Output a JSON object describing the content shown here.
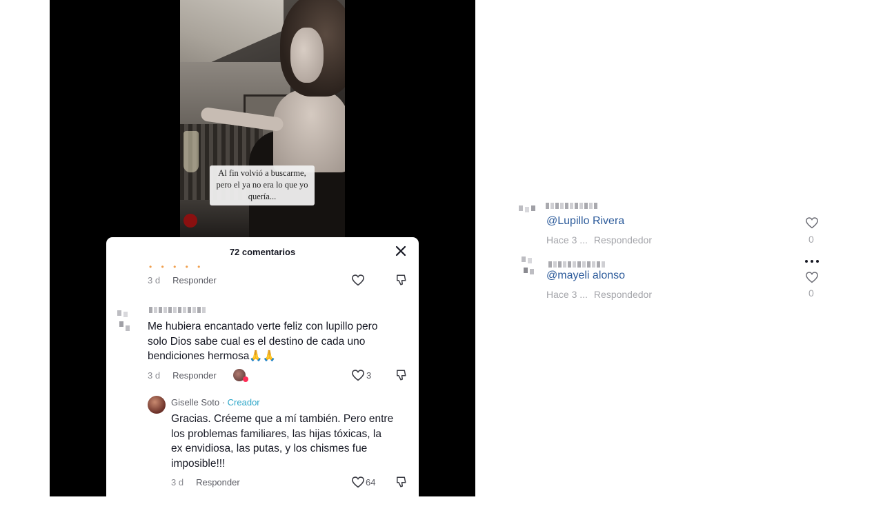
{
  "video": {
    "caption_lines": [
      "Al fin volvió a buscarme,",
      "pero el ya no era lo que yo",
      "quería..."
    ]
  },
  "comments_panel": {
    "title": "72 comentarios",
    "emoji_row": "• • • • •",
    "first_meta": {
      "time": "3 d",
      "reply": "Responder"
    },
    "comment": {
      "lines": [
        "Me hubiera encantado verte feliz con lupillo pero",
        "solo Dios sabe cual es el destino de cada uno",
        "bendiciones hermosa🙏🙏"
      ],
      "time": "3 d",
      "reply": "Responder",
      "likes": "3"
    },
    "creator_reply": {
      "author": "Giselle Soto",
      "separator": " · ",
      "badge": "Creador",
      "lines": [
        "Gracias. Créeme que a mí también. Pero entre",
        "los problemas familiares, las hijas tóxicas, la",
        "ex envidiosa, las putas, y los chismes fue",
        "imposible!!!"
      ],
      "time": "3 d",
      "reply": "Responder",
      "likes": "64"
    }
  },
  "right_comments": [
    {
      "mention": "@Lupillo Rivera",
      "time": "Hace 3 ...",
      "reply": "Respondedor",
      "likes": "0"
    },
    {
      "mention": "@mayeli alonso",
      "time": "Hace 3 ...",
      "reply": "Respondedor",
      "likes": "0"
    }
  ],
  "colors": {
    "accent_creator": "#2ca6c8",
    "mention": "#2b5a9a",
    "like_red": "#fe2c55"
  },
  "icons": [
    "close-icon",
    "heart-icon",
    "dislike-icon",
    "more-icon"
  ]
}
